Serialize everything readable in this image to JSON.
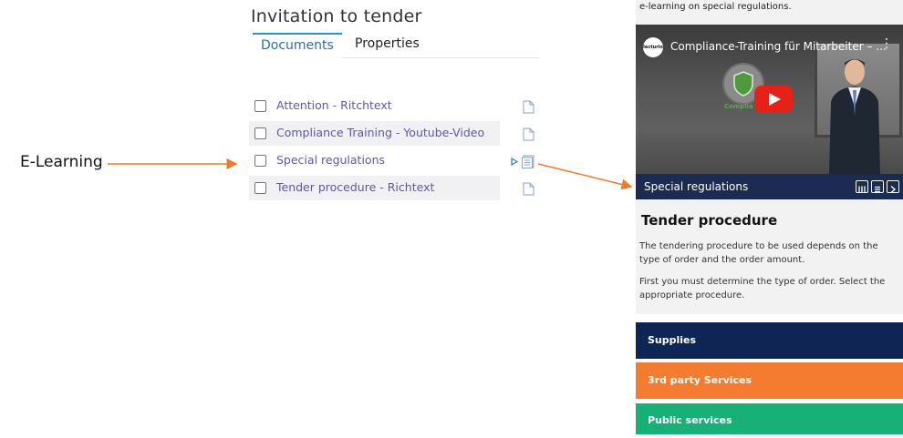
{
  "callout": {
    "label": "E-Learning"
  },
  "panel": {
    "title": "Invitation to tender",
    "tabs": [
      {
        "label": "Documents",
        "active": true
      },
      {
        "label": "Properties",
        "active": false
      }
    ],
    "documents": [
      {
        "label": "Attention - Ritchtext",
        "icon": "document-icon"
      },
      {
        "label": "Compliance Training - Youtube-Video",
        "icon": "document-icon"
      },
      {
        "label": "Special regulations",
        "icon": "document-list-icon",
        "expand_icon": "expand-arrow-icon"
      },
      {
        "label": "Tender procedure - Richtext",
        "icon": "document-icon"
      }
    ]
  },
  "preview": {
    "intro_text": "e-learning on special regulations.",
    "video": {
      "channel_logo": "lecturio",
      "title": "Compliance-Training für Mitarbeiter – ...",
      "menu_icon": "more-vertical-icon",
      "badge_caption": "Complia",
      "play_icon": "youtube-play-icon"
    },
    "bar": {
      "label": "Special regulations",
      "icons": [
        "library-icon",
        "document-icon",
        "next-icon"
      ]
    },
    "tender": {
      "heading": "Tender procedure",
      "paragraph1": "The tendering procedure to be used depends on the type of order and the order amount.",
      "paragraph2": "First you must determine the type of order. Select the appropriate procedure."
    },
    "choices": [
      {
        "label": "Supplies",
        "color": "#0f2553"
      },
      {
        "label": "3rd party Services",
        "color": "#f47c30"
      },
      {
        "label": "Public services",
        "color": "#17b178"
      }
    ]
  },
  "colors": {
    "accent_tab": "#2a8fd4",
    "link": "#5d56ad",
    "arrow": "#f07a2a"
  }
}
